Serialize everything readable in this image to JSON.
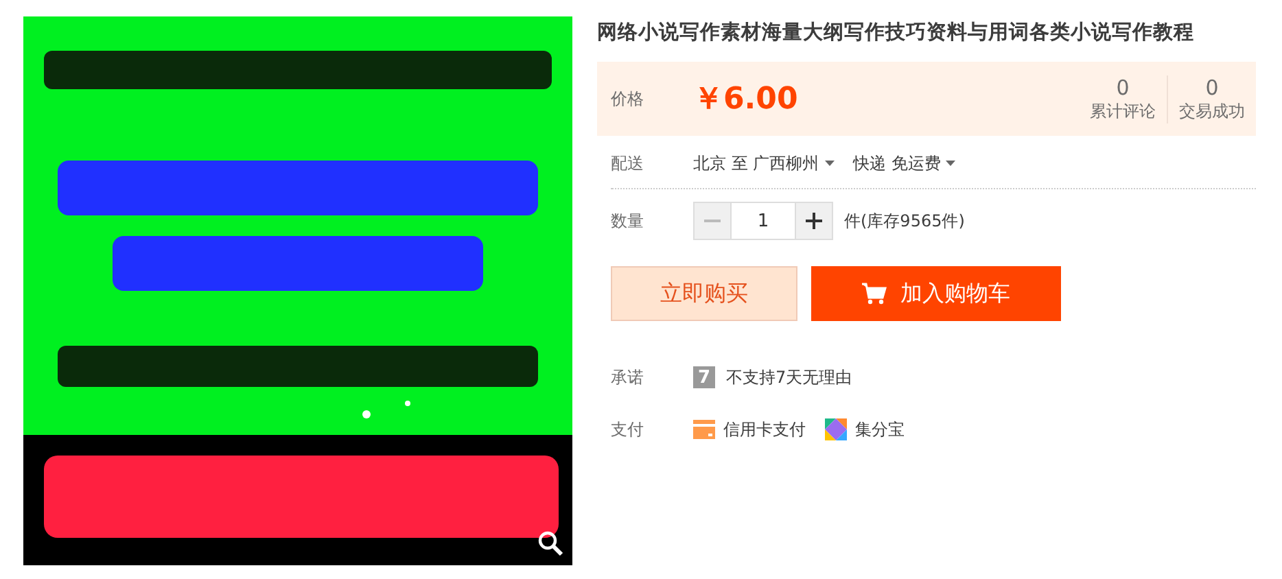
{
  "title": "网络小说写作素材海量大纲写作技巧资料与用词各类小说写作教程",
  "price": {
    "label": "价格",
    "value": "￥6.00"
  },
  "stats": [
    {
      "count": "0",
      "label": "累计评论"
    },
    {
      "count": "0",
      "label": "交易成功"
    }
  ],
  "delivery": {
    "label": "配送",
    "from": "北京 至",
    "to": "广西柳州",
    "shipping": "快递 免运费"
  },
  "quantity": {
    "label": "数量",
    "minus_disabled": true,
    "value": "1",
    "stock": "件(库存9565件)"
  },
  "buttons": [
    {
      "kind": "buy",
      "label": "立即购买"
    },
    {
      "kind": "cart",
      "label": "加入购物车"
    }
  ],
  "promise": {
    "label": "承诺",
    "icon_text": "7",
    "text": "不支持7天无理由"
  },
  "payment": {
    "label": "支付",
    "methods": [
      {
        "kind": "card",
        "label": "信用卡支付"
      },
      {
        "kind": "jifen",
        "label": "集分宝"
      }
    ]
  }
}
